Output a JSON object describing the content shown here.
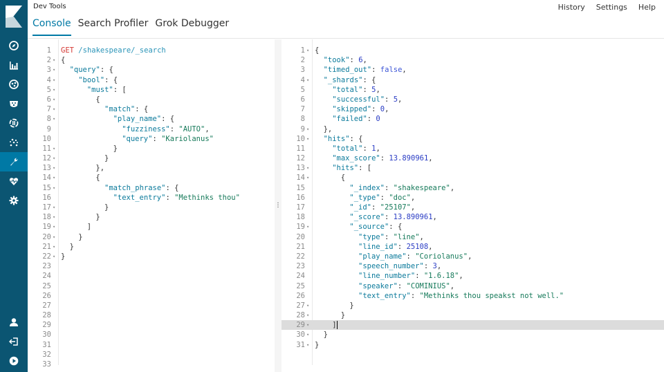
{
  "app": {
    "title": "Dev Tools",
    "tabs": [
      {
        "label": "Console",
        "active": true
      },
      {
        "label": "Search Profiler",
        "active": false
      },
      {
        "label": "Grok Debugger",
        "active": false
      }
    ],
    "links": [
      "History",
      "Settings",
      "Help"
    ]
  },
  "nav": {
    "top_items": [
      "discover-icon",
      "visualize-icon",
      "dashboard-icon",
      "timelion-icon",
      "canvas-icon",
      "graph-icon",
      "devtools-icon",
      "monitoring-icon",
      "management-icon"
    ],
    "active": "devtools-icon",
    "bottom_items": [
      "user-icon",
      "logout-icon",
      "collapse-icon"
    ]
  },
  "request": {
    "method": "GET",
    "path": "/shakespeare/_search",
    "total_lines": 33,
    "lines": [
      {
        "n": 1,
        "fold": false,
        "indent": 0,
        "html": "<span class='m'>GET</span> <span class='u'>/shakespeare/_search</span>"
      },
      {
        "n": 2,
        "fold": true,
        "indent": 0,
        "html": "{"
      },
      {
        "n": 3,
        "fold": true,
        "indent": 1,
        "html": "<span class='k'>\"query\"</span>: {"
      },
      {
        "n": 4,
        "fold": true,
        "indent": 2,
        "html": "<span class='k'>\"bool\"</span>: {"
      },
      {
        "n": 5,
        "fold": true,
        "indent": 3,
        "html": "<span class='k'>\"must\"</span>: ["
      },
      {
        "n": 6,
        "fold": true,
        "indent": 4,
        "html": "{"
      },
      {
        "n": 7,
        "fold": true,
        "indent": 5,
        "html": "<span class='k'>\"match\"</span>: {"
      },
      {
        "n": 8,
        "fold": true,
        "indent": 6,
        "html": "<span class='k'>\"play_name\"</span>: {"
      },
      {
        "n": 9,
        "fold": false,
        "indent": 7,
        "html": "<span class='k'>\"fuzziness\"</span>: <span class='s'>\"AUTO\"</span>,"
      },
      {
        "n": 10,
        "fold": false,
        "indent": 7,
        "html": "<span class='k'>\"query\"</span>: <span class='s'>\"Kariolanus\"</span>"
      },
      {
        "n": 11,
        "fold": true,
        "indent": 6,
        "html": "}"
      },
      {
        "n": 12,
        "fold": true,
        "indent": 5,
        "html": "}"
      },
      {
        "n": 13,
        "fold": true,
        "indent": 4,
        "html": "},"
      },
      {
        "n": 14,
        "fold": true,
        "indent": 4,
        "html": "{"
      },
      {
        "n": 15,
        "fold": true,
        "indent": 5,
        "html": "<span class='k'>\"match_phrase\"</span>: {"
      },
      {
        "n": 16,
        "fold": false,
        "indent": 6,
        "html": "<span class='k'>\"text_entry\"</span>: <span class='s'>\"Methinks thou\"</span>"
      },
      {
        "n": 17,
        "fold": true,
        "indent": 5,
        "html": "}"
      },
      {
        "n": 18,
        "fold": true,
        "indent": 4,
        "html": "}"
      },
      {
        "n": 19,
        "fold": true,
        "indent": 3,
        "html": "]"
      },
      {
        "n": 20,
        "fold": true,
        "indent": 2,
        "html": "}"
      },
      {
        "n": 21,
        "fold": true,
        "indent": 1,
        "html": "}"
      },
      {
        "n": 22,
        "fold": true,
        "indent": 0,
        "html": "}"
      }
    ]
  },
  "response": {
    "total_lines": 31,
    "active_line": 29,
    "lines": [
      {
        "n": 1,
        "fold": true,
        "indent": 0,
        "html": "{"
      },
      {
        "n": 2,
        "fold": false,
        "indent": 1,
        "html": "<span class='k'>\"took\"</span>: <span class='n'>6</span>,"
      },
      {
        "n": 3,
        "fold": false,
        "indent": 1,
        "html": "<span class='k'>\"timed_out\"</span>: <span class='b'>false</span>,"
      },
      {
        "n": 4,
        "fold": true,
        "indent": 1,
        "html": "<span class='k'>\"_shards\"</span>: {"
      },
      {
        "n": 5,
        "fold": false,
        "indent": 2,
        "html": "<span class='k'>\"total\"</span>: <span class='n'>5</span>,"
      },
      {
        "n": 6,
        "fold": false,
        "indent": 2,
        "html": "<span class='k'>\"successful\"</span>: <span class='n'>5</span>,"
      },
      {
        "n": 7,
        "fold": false,
        "indent": 2,
        "html": "<span class='k'>\"skipped\"</span>: <span class='n'>0</span>,"
      },
      {
        "n": 8,
        "fold": false,
        "indent": 2,
        "html": "<span class='k'>\"failed\"</span>: <span class='n'>0</span>"
      },
      {
        "n": 9,
        "fold": true,
        "indent": 1,
        "html": "},"
      },
      {
        "n": 10,
        "fold": true,
        "indent": 1,
        "html": "<span class='k'>\"hits\"</span>: {"
      },
      {
        "n": 11,
        "fold": false,
        "indent": 2,
        "html": "<span class='k'>\"total\"</span>: <span class='n'>1</span>,"
      },
      {
        "n": 12,
        "fold": false,
        "indent": 2,
        "html": "<span class='k'>\"max_score\"</span>: <span class='n'>13.890961</span>,"
      },
      {
        "n": 13,
        "fold": true,
        "indent": 2,
        "html": "<span class='k'>\"hits\"</span>: ["
      },
      {
        "n": 14,
        "fold": true,
        "indent": 3,
        "html": "{"
      },
      {
        "n": 15,
        "fold": false,
        "indent": 4,
        "html": "<span class='k'>\"_index\"</span>: <span class='s'>\"shakespeare\"</span>,"
      },
      {
        "n": 16,
        "fold": false,
        "indent": 4,
        "html": "<span class='k'>\"_type\"</span>: <span class='s'>\"doc\"</span>,"
      },
      {
        "n": 17,
        "fold": false,
        "indent": 4,
        "html": "<span class='k'>\"_id\"</span>: <span class='s'>\"25107\"</span>,"
      },
      {
        "n": 18,
        "fold": false,
        "indent": 4,
        "html": "<span class='k'>\"_score\"</span>: <span class='n'>13.890961</span>,"
      },
      {
        "n": 19,
        "fold": true,
        "indent": 4,
        "html": "<span class='k'>\"_source\"</span>: {"
      },
      {
        "n": 20,
        "fold": false,
        "indent": 5,
        "html": "<span class='k'>\"type\"</span>: <span class='s'>\"line\"</span>,"
      },
      {
        "n": 21,
        "fold": false,
        "indent": 5,
        "html": "<span class='k'>\"line_id\"</span>: <span class='n'>25108</span>,"
      },
      {
        "n": 22,
        "fold": false,
        "indent": 5,
        "html": "<span class='k'>\"play_name\"</span>: <span class='s'>\"Coriolanus\"</span>,"
      },
      {
        "n": 23,
        "fold": false,
        "indent": 5,
        "html": "<span class='k'>\"speech_number\"</span>: <span class='n'>3</span>,"
      },
      {
        "n": 24,
        "fold": false,
        "indent": 5,
        "html": "<span class='k'>\"line_number\"</span>: <span class='s'>\"1.6.18\"</span>,"
      },
      {
        "n": 25,
        "fold": false,
        "indent": 5,
        "html": "<span class='k'>\"speaker\"</span>: <span class='s'>\"COMINIUS\"</span>,"
      },
      {
        "n": 26,
        "fold": false,
        "indent": 5,
        "html": "<span class='k'>\"text_entry\"</span>: <span class='s'>\"Methinks thou speakst not well.\"</span>"
      },
      {
        "n": 27,
        "fold": true,
        "indent": 4,
        "html": "}"
      },
      {
        "n": 28,
        "fold": true,
        "indent": 3,
        "html": "}"
      },
      {
        "n": 29,
        "fold": true,
        "indent": 2,
        "html": "]<span class='cursor'></span>"
      },
      {
        "n": 30,
        "fold": true,
        "indent": 1,
        "html": "}"
      },
      {
        "n": 31,
        "fold": true,
        "indent": 0,
        "html": "}"
      }
    ]
  }
}
